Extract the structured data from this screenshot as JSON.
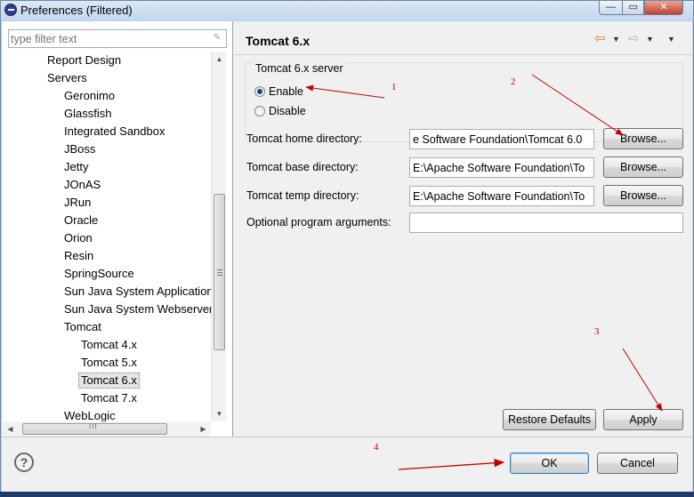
{
  "window": {
    "title": "Preferences (Filtered)",
    "minimize_glyph": "—",
    "maximize_glyph": "▭",
    "close_glyph": "✕"
  },
  "left": {
    "filter_placeholder": "type filter text",
    "tree": [
      {
        "label": "Report Design",
        "level": 1
      },
      {
        "label": "Servers",
        "level": 1
      },
      {
        "label": "Geronimo",
        "level": 2
      },
      {
        "label": "Glassfish",
        "level": 2
      },
      {
        "label": "Integrated Sandbox",
        "level": 2
      },
      {
        "label": "JBoss",
        "level": 2
      },
      {
        "label": "Jetty",
        "level": 2
      },
      {
        "label": "JOnAS",
        "level": 2
      },
      {
        "label": "JRun",
        "level": 2
      },
      {
        "label": "Oracle",
        "level": 2
      },
      {
        "label": "Orion",
        "level": 2
      },
      {
        "label": "Resin",
        "level": 2
      },
      {
        "label": "SpringSource",
        "level": 2
      },
      {
        "label": "Sun Java System Application",
        "level": 2
      },
      {
        "label": "Sun Java System Webserver",
        "level": 2
      },
      {
        "label": "Tomcat",
        "level": 2
      },
      {
        "label": "Tomcat  4.x",
        "level": 3
      },
      {
        "label": "Tomcat  5.x",
        "level": 3
      },
      {
        "label": "Tomcat  6.x",
        "level": 3,
        "selected": true
      },
      {
        "label": "Tomcat  7.x",
        "level": 3
      },
      {
        "label": "WebLogic",
        "level": 2
      }
    ],
    "hscroll_grip": "III"
  },
  "right": {
    "page_title": "Tomcat  6.x",
    "group_title": "Tomcat  6.x server",
    "radio_enable": "Enable",
    "radio_disable": "Disable",
    "enable_checked": true,
    "fields": {
      "home_label": "Tomcat home directory:",
      "home_value": "e Software Foundation\\Tomcat 6.0",
      "base_label": "Tomcat base directory:",
      "base_value": "E:\\Apache Software Foundation\\To",
      "temp_label": "Tomcat temp directory:",
      "temp_value": "E:\\Apache Software Foundation\\To",
      "args_label": "Optional program arguments:",
      "args_value": ""
    },
    "browse_label": "Browse...",
    "restore_label": "Restore Defaults",
    "apply_label": "Apply"
  },
  "footer": {
    "help_glyph": "?",
    "ok_label": "OK",
    "cancel_label": "Cancel"
  },
  "annotations": {
    "n1": "1",
    "n2": "2",
    "n3": "3",
    "n4": "4",
    "color": "#c00000"
  }
}
